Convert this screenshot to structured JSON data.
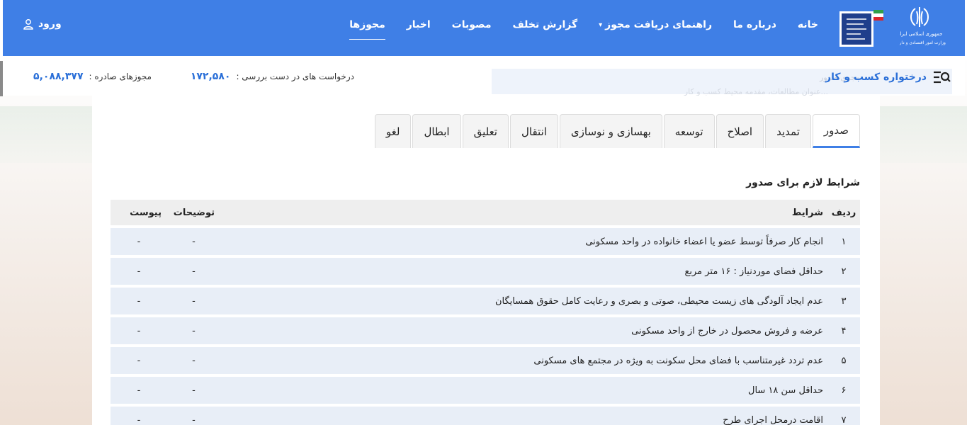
{
  "header": {
    "nav": [
      {
        "label": "خانه",
        "active": false,
        "dropdown": false
      },
      {
        "label": "درباره ما",
        "active": false,
        "dropdown": false
      },
      {
        "label": "راهنمای دریافت مجوز",
        "active": false,
        "dropdown": true
      },
      {
        "label": "گزارش تخلف",
        "active": false,
        "dropdown": false
      },
      {
        "label": "مصوبات",
        "active": false,
        "dropdown": false
      },
      {
        "label": "اخبار",
        "active": false,
        "dropdown": false
      },
      {
        "label": "مجوزها",
        "active": true,
        "dropdown": false
      }
    ],
    "login_label": "ورود",
    "logo1_text": "جمهوری اسلامی ایران وزارت امور اقتصادی و دارایی",
    "brand_color": "#3f7fe6"
  },
  "stats": {
    "request_title": "درختواره کسب و کار",
    "search_hint_1": "مجری صدور",
    "search_hint_2": "...عنوان مطالعات، مقدمه محیط کسب و کار",
    "pending_label": "درخواست های در دست بررسی :",
    "pending_value": "۱۷۲,۵۸۰",
    "issued_label": "مجوزهای صادره :",
    "issued_value": "۵,۰۸۸,۳۷۷"
  },
  "tabs": [
    {
      "label": "صدور",
      "active": true
    },
    {
      "label": "تمدید",
      "active": false
    },
    {
      "label": "اصلاح",
      "active": false
    },
    {
      "label": "توسعه",
      "active": false
    },
    {
      "label": "بهسازی و نوسازی",
      "active": false
    },
    {
      "label": "انتقال",
      "active": false
    },
    {
      "label": "تعلیق",
      "active": false
    },
    {
      "label": "ابطال",
      "active": false
    },
    {
      "label": "لغو",
      "active": false
    }
  ],
  "section_title": "شرایط لازم برای صدور",
  "table": {
    "headers": {
      "index": "ردیف",
      "condition": "شرایط",
      "description": "توضیحات",
      "attachment": "پیوست"
    },
    "rows": [
      {
        "index": "۱",
        "condition": "انجام کار صرفاً توسط عضو یا اعضاء خانواده در واحد مسکونی",
        "description": "-",
        "attachment": "-"
      },
      {
        "index": "۲",
        "condition": "حداقل فضای موردنیاز : ۱۶ متر مربع",
        "description": "-",
        "attachment": "-"
      },
      {
        "index": "۳",
        "condition": "عدم ایجاد آلودگی های زیست محیطی، صوتی و بصری و رعایت کامل حقوق همسایگان",
        "description": "-",
        "attachment": "-"
      },
      {
        "index": "۴",
        "condition": "عرضه و فروش محصول در خارج از واحد مسکونی",
        "description": "-",
        "attachment": "-"
      },
      {
        "index": "۵",
        "condition": "عدم تردد غیرمتناسب با فضای محل سکونت به ویژه در مجتمع های مسکونی",
        "description": "-",
        "attachment": "-"
      },
      {
        "index": "۶",
        "condition": "حداقل سن ۱۸ سال",
        "description": "-",
        "attachment": "-"
      },
      {
        "index": "۷",
        "condition": "اقامت درمحل اجرای طرح",
        "description": "-",
        "attachment": "-"
      }
    ]
  }
}
